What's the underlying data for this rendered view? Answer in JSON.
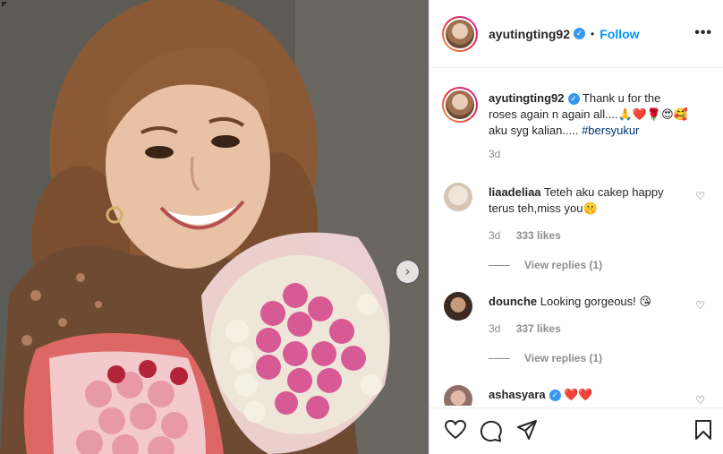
{
  "post": {
    "author": "ayutingting92",
    "follow_label": "Follow",
    "separator": "•",
    "more_label": "•••",
    "caption_line1": "Thank u for the",
    "caption_line2": "roses again n again all....🙏❤️🌹😍🥰",
    "caption_line3": "aku syg kalian.....",
    "hashtag": "#bersyukur",
    "caption_time": "3d"
  },
  "comments": [
    {
      "user": "liaadeliaa",
      "text_line1": "Teteh aku cakep happy",
      "text_line2": "terus teh,miss you🤫",
      "time": "3d",
      "likes": "333 likes",
      "view_replies": "View replies (1)"
    },
    {
      "user": "dounche",
      "text": "Looking gorgeous! 😘",
      "time": "3d",
      "likes": "337 likes",
      "view_replies": "View replies (1)"
    },
    {
      "user": "ashasyara",
      "text": "❤️❤️"
    }
  ],
  "icons": {
    "verified": "verified-badge-icon",
    "heart": "heart-icon",
    "comment": "comment-icon",
    "share": "share-icon",
    "save": "bookmark-icon",
    "next": "chevron-right-icon"
  },
  "colors": {
    "accent": "#0095f6",
    "verified": "#3897f0",
    "hashtag": "#00376b",
    "muted": "#8e8e8e"
  }
}
